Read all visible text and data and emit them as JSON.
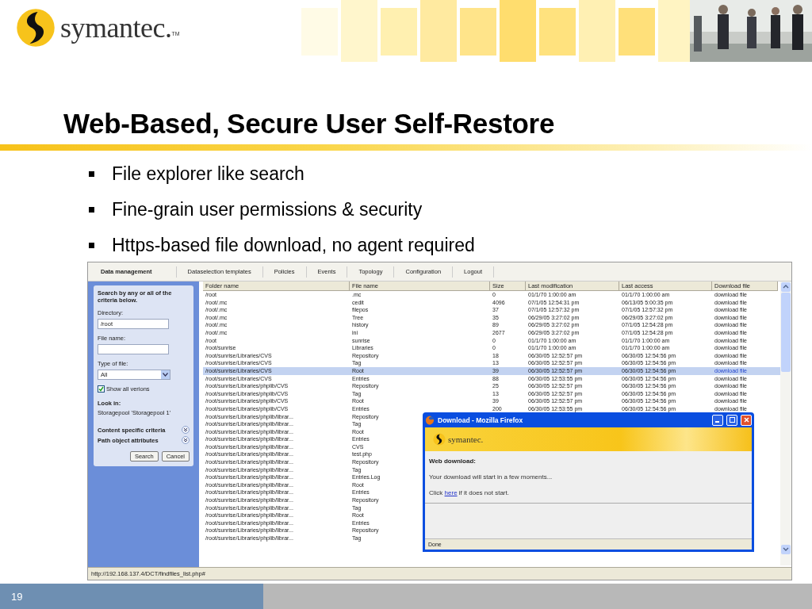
{
  "logo": {
    "text": "symantec.",
    "mark": "TM"
  },
  "title": "Web-Based, Secure User Self-Restore",
  "bullets": [
    "File explorer like search",
    "Fine-grain user permissions & security",
    "Https-based file download, no agent required"
  ],
  "app": {
    "tabs": [
      {
        "label": "Data management",
        "selected": true
      },
      {
        "label": "Dataselection templates",
        "selected": false
      },
      {
        "label": "Policies",
        "selected": false
      },
      {
        "label": "Events",
        "selected": false
      },
      {
        "label": "Topology",
        "selected": false
      },
      {
        "label": "Configuration",
        "selected": false
      },
      {
        "label": "Logout",
        "selected": false
      }
    ],
    "search_panel": {
      "intro": "Search by any or all of the criteria below.",
      "directory_label": "Directory:",
      "directory_value": "/root",
      "file_name_label": "File name:",
      "type_label": "Type of file:",
      "type_value": "All",
      "show_all": {
        "label": "Show all verions",
        "checked": true
      },
      "look_in_label": "Look in:",
      "look_in_value": "Storagepool 'Storagepool 1'",
      "sections": [
        {
          "label": "Content specific criteria",
          "expanded": false
        },
        {
          "label": "Path object attributes",
          "expanded": false
        }
      ],
      "buttons": [
        "Search",
        "Cancel"
      ]
    },
    "table": {
      "columns": [
        "Folder name",
        "File name",
        "Size",
        "Last modification",
        "Last access",
        "Download file"
      ],
      "rows": [
        {
          "selected": false,
          "cells": [
            "/root",
            ".mc",
            "0",
            "01/1/70 1:00:00 am",
            "01/1/70 1:00:00 am",
            "download file"
          ]
        },
        {
          "selected": false,
          "cells": [
            "/root/.mc",
            "cedit",
            "4096",
            "07/1/05 12:54:31 pm",
            "06/13/05 5:00:35 pm",
            "download file"
          ]
        },
        {
          "selected": false,
          "cells": [
            "/root/.mc",
            "filepos",
            "37",
            "07/1/05 12:57:32 pm",
            "07/1/05 12:57:32 pm",
            "download file"
          ]
        },
        {
          "selected": false,
          "cells": [
            "/root/.mc",
            "Tree",
            "35",
            "06/29/05 3:27:02 pm",
            "06/29/05 3:27:02 pm",
            "download file"
          ]
        },
        {
          "selected": false,
          "cells": [
            "/root/.mc",
            "history",
            "89",
            "06/29/05 3:27:02 pm",
            "07/1/05 12:54:28 pm",
            "download file"
          ]
        },
        {
          "selected": false,
          "cells": [
            "/root/.mc",
            "ini",
            "2677",
            "06/29/05 3:27:02 pm",
            "07/1/05 12:54:28 pm",
            "download file"
          ]
        },
        {
          "selected": false,
          "cells": [
            "/root",
            "sunrise",
            "0",
            "01/1/70 1:00:00 am",
            "01/1/70 1:00:00 am",
            "download file"
          ]
        },
        {
          "selected": false,
          "cells": [
            "/root/sunrise",
            "Libraries",
            "0",
            "01/1/70 1:00:00 am",
            "01/1/70 1:00:00 am",
            "download file"
          ]
        },
        {
          "selected": false,
          "cells": [
            "/root/sunrise/Libraries/CVS",
            "Repository",
            "18",
            "06/30/05 12:52:57 pm",
            "06/30/05 12:54:56 pm",
            "download file"
          ]
        },
        {
          "selected": false,
          "cells": [
            "/root/sunrise/Libraries/CVS",
            "Tag",
            "13",
            "06/30/05 12:52:57 pm",
            "06/30/05 12:54:56 pm",
            "download file"
          ]
        },
        {
          "selected": true,
          "cells": [
            "/root/sunrise/Libraries/CVS",
            "Root",
            "39",
            "06/30/05 12:52:57 pm",
            "06/30/05 12:54:56 pm",
            "download file"
          ]
        },
        {
          "selected": false,
          "cells": [
            "/root/sunrise/Libraries/CVS",
            "Entries",
            "88",
            "06/30/05 12:53:55 pm",
            "06/30/05 12:54:56 pm",
            "download file"
          ]
        },
        {
          "selected": false,
          "cells": [
            "/root/sunrise/Libraries/phplib/CVS",
            "Repository",
            "25",
            "06/30/05 12:52:57 pm",
            "06/30/05 12:54:56 pm",
            "download file"
          ]
        },
        {
          "selected": false,
          "cells": [
            "/root/sunrise/Libraries/phplib/CVS",
            "Tag",
            "13",
            "06/30/05 12:52:57 pm",
            "06/30/05 12:54:56 pm",
            "download file"
          ]
        },
        {
          "selected": false,
          "cells": [
            "/root/sunrise/Libraries/phplib/CVS",
            "Root",
            "39",
            "06/30/05 12:52:57 pm",
            "06/30/05 12:54:56 pm",
            "download file"
          ]
        },
        {
          "selected": false,
          "cells": [
            "/root/sunrise/Libraries/phplib/CVS",
            "Entries",
            "200",
            "06/30/05 12:53:55 pm",
            "06/30/05 12:54:56 pm",
            "download file"
          ]
        },
        {
          "selected": false,
          "cells": [
            "/root/sunrise/Libraries/phplib/librar...",
            "Repository"
          ]
        },
        {
          "selected": false,
          "cells": [
            "/root/sunrise/Libraries/phplib/librar...",
            "Tag"
          ]
        },
        {
          "selected": false,
          "cells": [
            "/root/sunrise/Libraries/phplib/librar...",
            "Root"
          ]
        },
        {
          "selected": false,
          "cells": [
            "/root/sunrise/Libraries/phplib/librar...",
            "Entries"
          ]
        },
        {
          "selected": false,
          "cells": [
            "/root/sunrise/Libraries/phplib/librar...",
            "CVS"
          ]
        },
        {
          "selected": false,
          "cells": [
            "/root/sunrise/Libraries/phplib/librar...",
            "test.php"
          ]
        },
        {
          "selected": false,
          "cells": [
            "/root/sunrise/Libraries/phplib/librar...",
            "Repository"
          ]
        },
        {
          "selected": false,
          "cells": [
            "/root/sunrise/Libraries/phplib/librar...",
            "Tag"
          ]
        },
        {
          "selected": false,
          "cells": [
            "/root/sunrise/Libraries/phplib/librar...",
            "Entries.Log"
          ]
        },
        {
          "selected": false,
          "cells": [
            "/root/sunrise/Libraries/phplib/librar...",
            "Root"
          ]
        },
        {
          "selected": false,
          "cells": [
            "/root/sunrise/Libraries/phplib/librar...",
            "Entries"
          ]
        },
        {
          "selected": false,
          "cells": [
            "/root/sunrise/Libraries/phplib/librar...",
            "Repository"
          ]
        },
        {
          "selected": false,
          "cells": [
            "/root/sunrise/Libraries/phplib/librar...",
            "Tag"
          ]
        },
        {
          "selected": false,
          "cells": [
            "/root/sunrise/Libraries/phplib/librar...",
            "Root"
          ]
        },
        {
          "selected": false,
          "cells": [
            "/root/sunrise/Libraries/phplib/librar...",
            "Entries"
          ]
        },
        {
          "selected": false,
          "cells": [
            "/root/sunrise/Libraries/phplib/librar...",
            "Repository"
          ]
        },
        {
          "selected": false,
          "cells": [
            "/root/sunrise/Libraries/phplib/librar...",
            "Tag"
          ]
        }
      ]
    },
    "status_bar": "http://192.168.137.4/DCT/findfiles_list.php#"
  },
  "popup": {
    "title": "Download - Mozilla Firefox",
    "logo_text": "symantec.",
    "heading": "Web download:",
    "message": "Your download will start in a few moments...",
    "retry_before": "Click ",
    "retry_link": "here",
    "retry_after": " if it does not start.",
    "status": "Done"
  },
  "slide_number": "19"
}
